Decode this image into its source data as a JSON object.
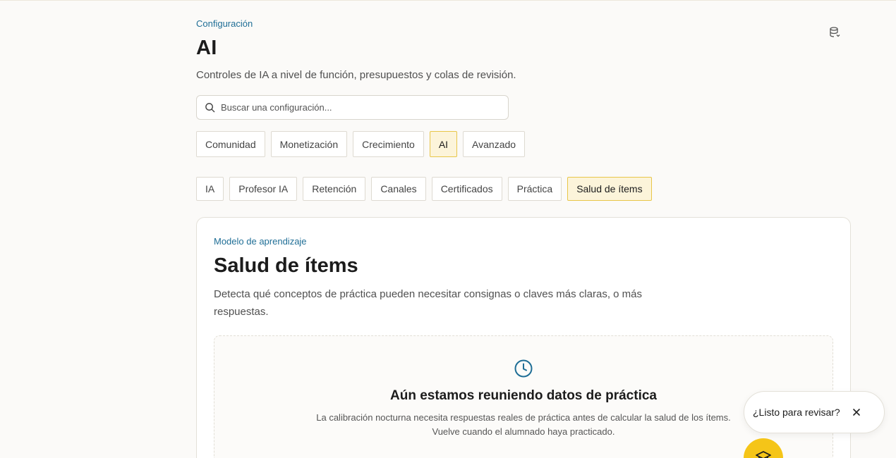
{
  "header": {
    "eyebrow": "Configuración",
    "title": "AI",
    "subtitle": "Controles de IA a nivel de función, presupuestos y colas de revisión."
  },
  "toolbar": {
    "db_icon": "database-icon"
  },
  "search": {
    "placeholder": "Buscar una configuración...",
    "value": "",
    "icon": "search-icon"
  },
  "primary_tabs": [
    {
      "label": "Comunidad",
      "active": false
    },
    {
      "label": "Monetización",
      "active": false
    },
    {
      "label": "Crecimiento",
      "active": false
    },
    {
      "label": "AI",
      "active": true
    },
    {
      "label": "Avanzado",
      "active": false
    }
  ],
  "secondary_tabs": [
    {
      "label": "IA",
      "active": false
    },
    {
      "label": "Profesor IA",
      "active": false
    },
    {
      "label": "Retención",
      "active": false
    },
    {
      "label": "Canales",
      "active": false
    },
    {
      "label": "Certificados",
      "active": false
    },
    {
      "label": "Práctica",
      "active": false
    },
    {
      "label": "Salud de ítems",
      "active": true
    }
  ],
  "card": {
    "eyebrow": "Modelo de aprendizaje",
    "title": "Salud de ítems",
    "description": "Detecta qué conceptos de práctica pueden necesitar consignas o claves más claras, o más respuestas.",
    "empty_state": {
      "icon": "clock-icon",
      "title": "Aún estamos reuniendo datos de práctica",
      "line1": "La calibración nocturna necesita respuestas reales de práctica antes de calcular la salud de los ítems.",
      "line2": "Vuelve cuando el alumnado haya practicado."
    }
  },
  "toast": {
    "text": "¿Listo para revisar?",
    "close_icon": "close-icon"
  },
  "fab": {
    "icon": "graduation-cap-icon"
  },
  "colors": {
    "accent": "#1f6e96",
    "active_tab_bg": "#fcf4da",
    "active_tab_border": "#e8c649",
    "fab": "#f5c518",
    "background": "#fbfaf8"
  }
}
